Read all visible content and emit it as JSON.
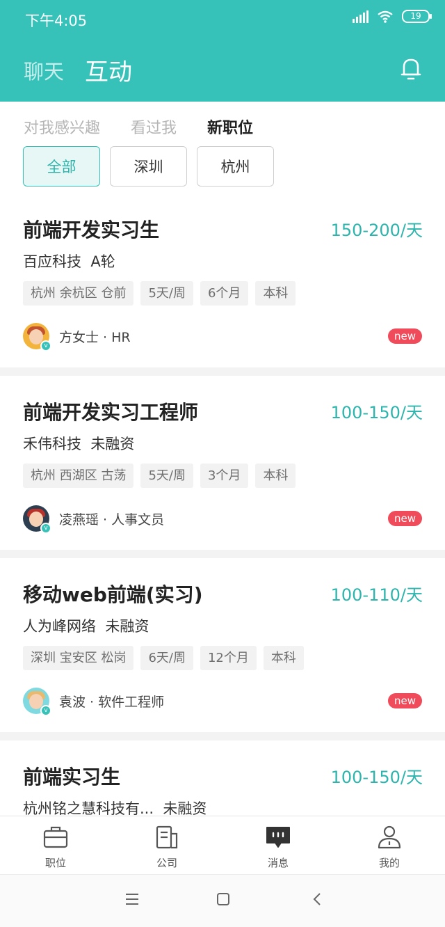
{
  "status_bar": {
    "time": "下午4:05",
    "battery": "19"
  },
  "header": {
    "tabs": [
      {
        "label": "聊天",
        "active": false
      },
      {
        "label": "互动",
        "active": true
      }
    ]
  },
  "subtabs": [
    {
      "label": "对我感兴趣",
      "active": false
    },
    {
      "label": "看过我",
      "active": false
    },
    {
      "label": "新职位",
      "active": true
    }
  ],
  "city_filters": [
    {
      "label": "全部",
      "active": true
    },
    {
      "label": "深圳",
      "active": false
    },
    {
      "label": "杭州",
      "active": false
    }
  ],
  "jobs": [
    {
      "title": "前端开发实习生",
      "salary": "150-200/天",
      "company": "百应科技  A轮",
      "tags": [
        "杭州 余杭区 仓前",
        "5天/周",
        "6个月",
        "本科"
      ],
      "recruiter": "方女士 · HR",
      "badge": "new"
    },
    {
      "title": "前端开发实习工程师",
      "salary": "100-150/天",
      "company": "禾伟科技  未融资",
      "tags": [
        "杭州 西湖区 古荡",
        "5天/周",
        "3个月",
        "本科"
      ],
      "recruiter": "凌燕瑶 · 人事文员",
      "badge": "new"
    },
    {
      "title": "移动web前端(实习)",
      "salary": "100-110/天",
      "company": "人为峰网络  未融资",
      "tags": [
        "深圳 宝安区 松岗",
        "6天/周",
        "12个月",
        "本科"
      ],
      "recruiter": "袁波 · 软件工程师",
      "badge": "new"
    },
    {
      "title": "前端实习生",
      "salary": "100-150/天",
      "company": "杭州铭之慧科技有...  未融资"
    }
  ],
  "bottom_nav": [
    {
      "label": "职位",
      "icon": "briefcase-icon"
    },
    {
      "label": "公司",
      "icon": "building-icon"
    },
    {
      "label": "消息",
      "icon": "message-icon"
    },
    {
      "label": "我的",
      "icon": "profile-icon"
    }
  ],
  "colors": {
    "accent": "#36c1b9",
    "badge": "#f04b5a"
  }
}
